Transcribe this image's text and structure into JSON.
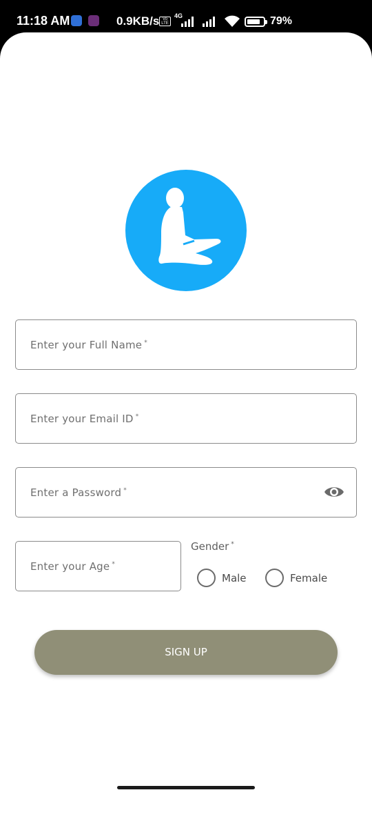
{
  "status_bar": {
    "time": "11:18 AM",
    "network_speed": "0.9KB/s",
    "volte_label": "Vo LTE",
    "network_type": "4G",
    "battery_percent": "79%",
    "icons": [
      "app-notification-icon",
      "app-notification-icon",
      "volte-icon",
      "cell-signal-icon",
      "cell-signal-icon",
      "wifi-icon",
      "battery-icon"
    ]
  },
  "logo": {
    "icon": "meditation-figure-icon",
    "color": "#17abf8"
  },
  "form": {
    "full_name": {
      "placeholder": "Enter your Full Name",
      "required_mark": "*",
      "value": ""
    },
    "email": {
      "placeholder": "Enter your Email ID",
      "required_mark": "*",
      "value": ""
    },
    "password": {
      "placeholder": "Enter a Password",
      "required_mark": "*",
      "value": "",
      "toggle_icon": "eye-icon"
    },
    "age": {
      "placeholder": "Enter your Age",
      "required_mark": "*",
      "value": ""
    },
    "gender": {
      "label": "Gender",
      "required_mark": "*",
      "options": [
        "Male",
        "Female"
      ],
      "selected": null
    },
    "submit_label": "SIGN UP"
  },
  "colors": {
    "button": "#908f77",
    "logo_bg": "#17abf8",
    "field_border": "#8a8a8a"
  }
}
